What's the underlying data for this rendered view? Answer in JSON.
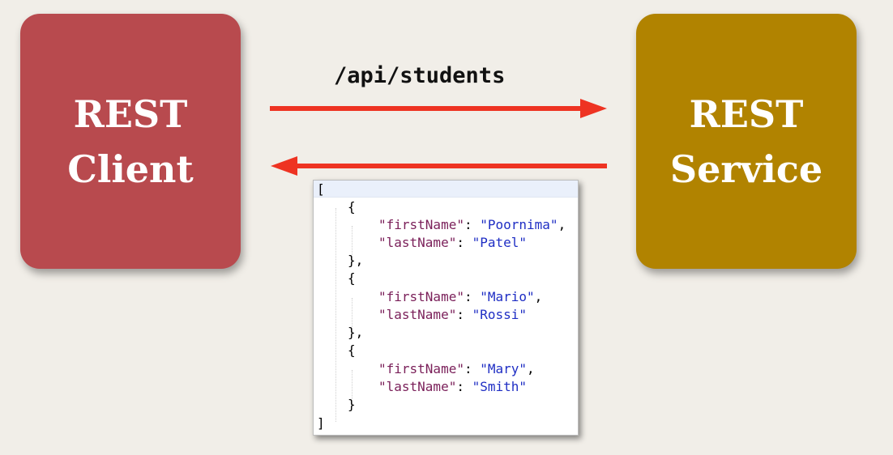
{
  "client": {
    "line1": "REST",
    "line2": "Client",
    "color": "#b84a4e"
  },
  "service": {
    "line1": "REST",
    "line2": "Service",
    "color": "#b18300"
  },
  "request": {
    "endpoint": "/api/students",
    "arrow_color": "#ee3322"
  },
  "response": {
    "open_bracket": "[",
    "close_bracket": "]",
    "open_brace": "{",
    "close_brace": "}",
    "close_brace_comma": "},",
    "comma": ",",
    "separator": ": ",
    "students": [
      {
        "first_key": "\"firstName\"",
        "first_value": "\"Poornima\"",
        "last_key": "\"lastName\"",
        "last_value": "\"Patel\""
      },
      {
        "first_key": "\"firstName\"",
        "first_value": "\"Mario\"",
        "last_key": "\"lastName\"",
        "last_value": "\"Rossi\""
      },
      {
        "first_key": "\"firstName\"",
        "first_value": "\"Mary\"",
        "last_key": "\"lastName\"",
        "last_value": "\"Smith\""
      }
    ]
  }
}
